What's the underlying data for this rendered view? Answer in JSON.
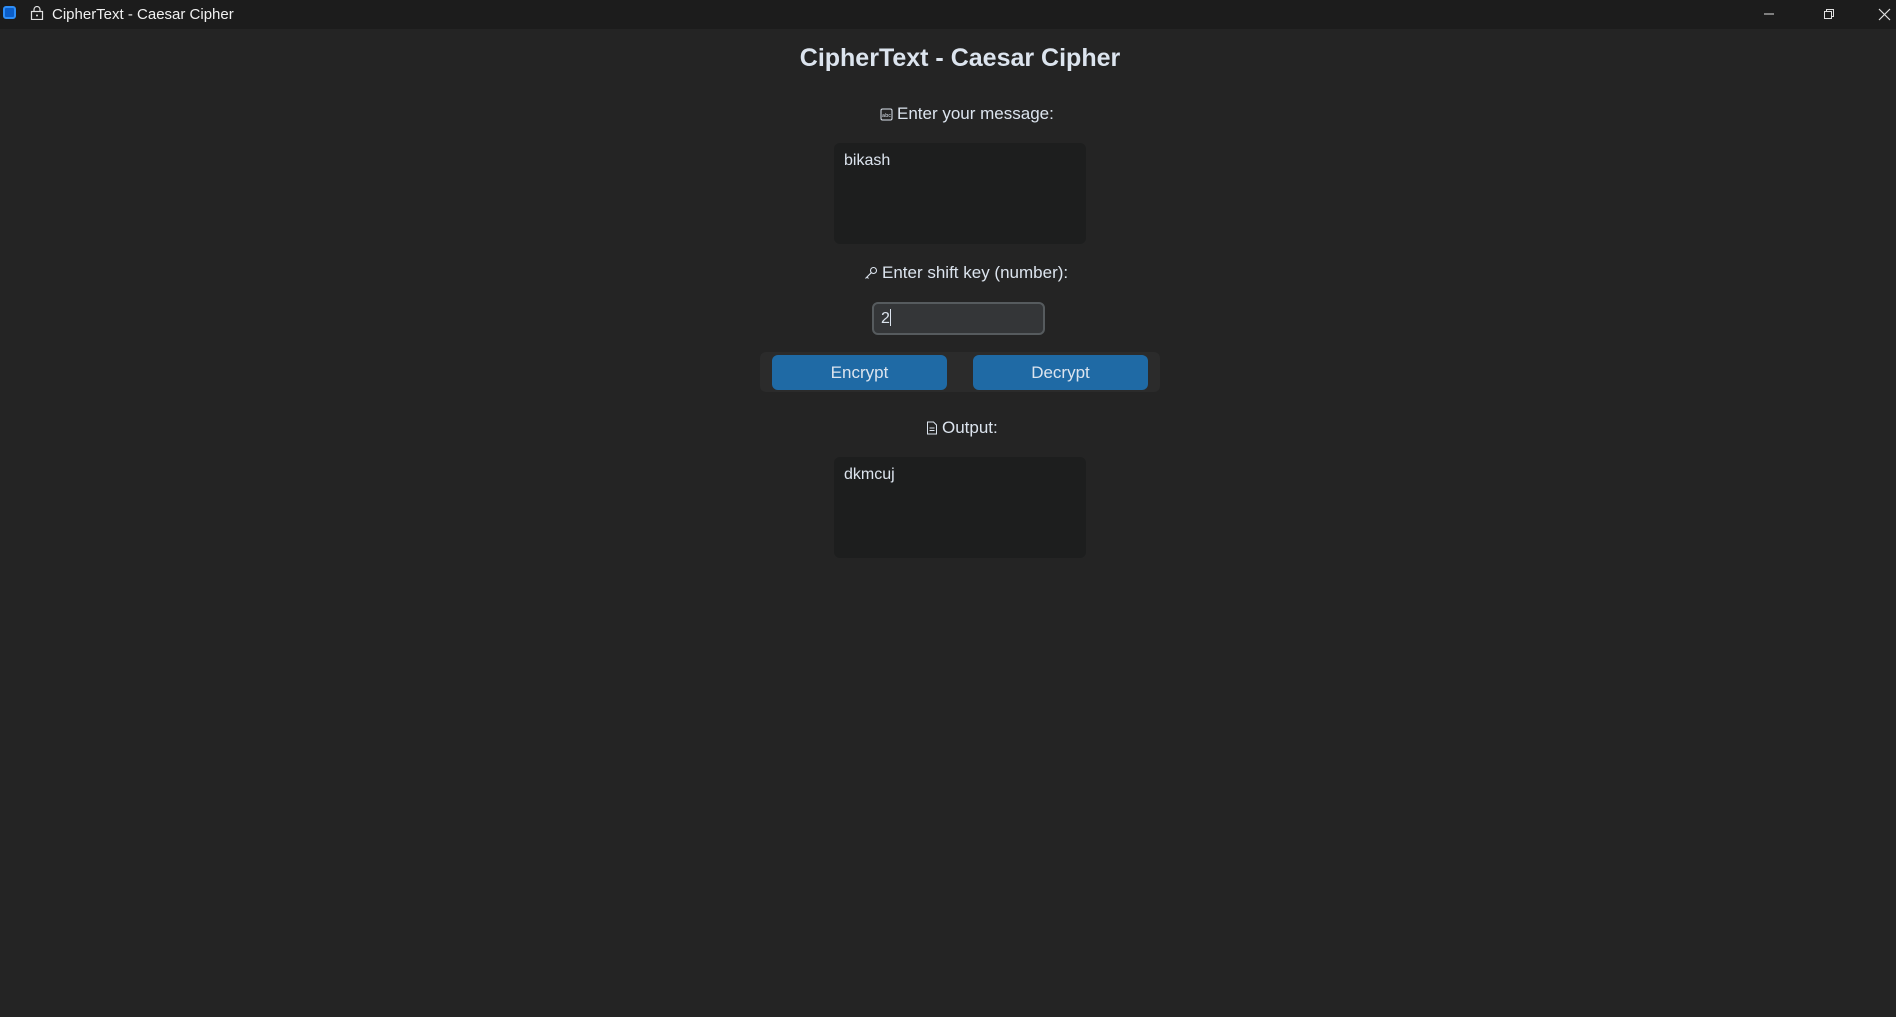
{
  "window": {
    "title": "CipherText - Caesar Cipher",
    "title_emoji": "lock-icon"
  },
  "heading": "CipherText - Caesar Cipher",
  "message": {
    "label": "Enter your message:",
    "icon": "abc-input-icon",
    "value": "bikash"
  },
  "shift": {
    "label": "Enter shift key (number):",
    "icon": "key-icon",
    "value": "2"
  },
  "buttons": {
    "encrypt": "Encrypt",
    "decrypt": "Decrypt"
  },
  "output": {
    "label": "Output:",
    "icon": "document-icon",
    "value": "dkmcuj"
  },
  "colors": {
    "background": "#242424",
    "accent": "#1f6aa5",
    "textbox": "#1d1e1e",
    "entry": "#343638"
  }
}
